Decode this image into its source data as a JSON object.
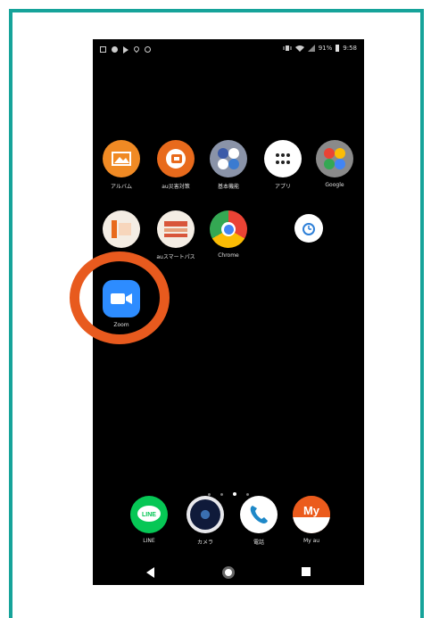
{
  "status_bar": {
    "right_text": "91%",
    "time": "9:58"
  },
  "apps_row1": [
    {
      "label": "アルバム",
      "icon": "album-icon",
      "color": "#f08a24"
    },
    {
      "label": "au災害対策",
      "icon": "au-disaster-icon",
      "color": "#e86a1c"
    },
    {
      "label": "基本機能",
      "icon": "folder-icon",
      "color": "#5a6fb3"
    },
    {
      "label": "アプリ",
      "icon": "apps-grid-icon",
      "color": "#ffffff"
    },
    {
      "label": "Google",
      "icon": "google-folder-icon",
      "color": "#8a8a8a"
    }
  ],
  "apps_row2": [
    {
      "label": "ービスTOP",
      "icon": "au-service-icon",
      "color": "#e86a1c"
    },
    {
      "label": "auスマートパス",
      "icon": "smartpass-icon",
      "color": "#e86a1c"
    },
    {
      "label": "Chrome",
      "icon": "chrome-icon"
    },
    {
      "label": "",
      "icon": "clock-icon",
      "color": "#2d7fd8"
    }
  ],
  "zoom_app": {
    "label": "Zoom",
    "icon": "zoom-icon",
    "color": "#2d8cff"
  },
  "dock": [
    {
      "label": "LINE",
      "icon": "line-icon",
      "color": "#06c755"
    },
    {
      "label": "カメラ",
      "icon": "camera-icon",
      "color": "#1a2a5a"
    },
    {
      "label": "電話",
      "icon": "phone-icon",
      "color": "#1e88c8"
    },
    {
      "label": "My au",
      "icon": "my-au-icon",
      "color": "#eb5b1c"
    }
  ],
  "page_indicator": {
    "pages": 4,
    "active": 2
  },
  "highlight_color": "#e85a1e"
}
